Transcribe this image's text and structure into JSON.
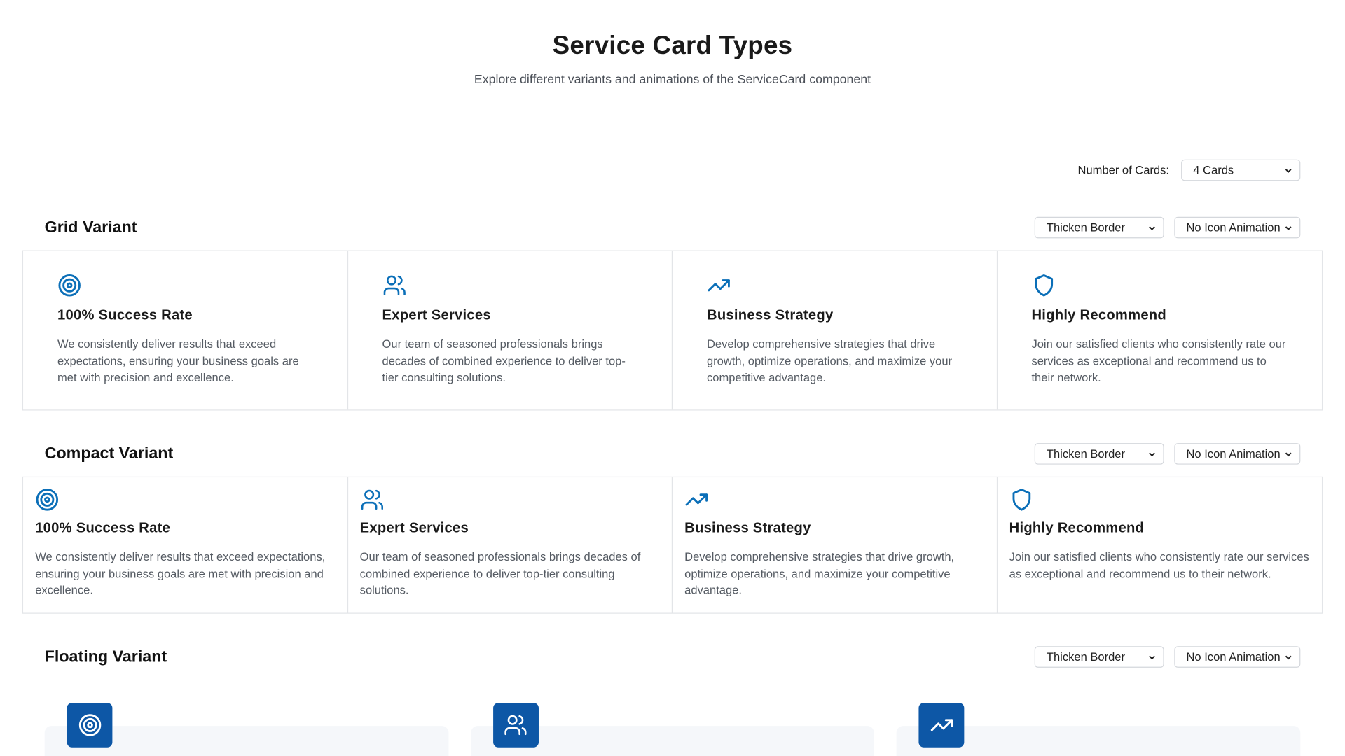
{
  "header": {
    "title": "Service Card Types",
    "subtitle": "Explore different variants and animations of the ServiceCard component"
  },
  "card_count": {
    "label": "Number of Cards:",
    "selected": "4 Cards"
  },
  "cards": [
    {
      "icon": "target-icon",
      "title": "100% Success Rate",
      "description": "We consistently deliver results that exceed expectations, ensuring your business goals are met with precision and excellence."
    },
    {
      "icon": "users-icon",
      "title": "Expert Services",
      "description": "Our team of seasoned professionals brings decades of combined experience to deliver top-tier consulting solutions."
    },
    {
      "icon": "trending-up-icon",
      "title": "Business Strategy",
      "description": "Develop comprehensive strategies that drive growth, optimize operations, and maximize your competitive advantage."
    },
    {
      "icon": "shield-icon",
      "title": "Highly Recommend",
      "description": "Join our satisfied clients who consistently rate our services as exceptional and recommend us to their network."
    }
  ],
  "sections": {
    "grid": {
      "title": "Grid Variant",
      "border": "Thicken Border",
      "animation": "No Icon Animation"
    },
    "compact": {
      "title": "Compact Variant",
      "border": "Thicken Border",
      "animation": "No Icon Animation"
    },
    "floating": {
      "title": "Floating Variant",
      "border": "Thicken Border",
      "animation": "No Icon Animation"
    }
  },
  "colors": {
    "accent": "#0b6fb8",
    "floating_badge": "#0d57a6",
    "border": "#e3e5e8"
  }
}
